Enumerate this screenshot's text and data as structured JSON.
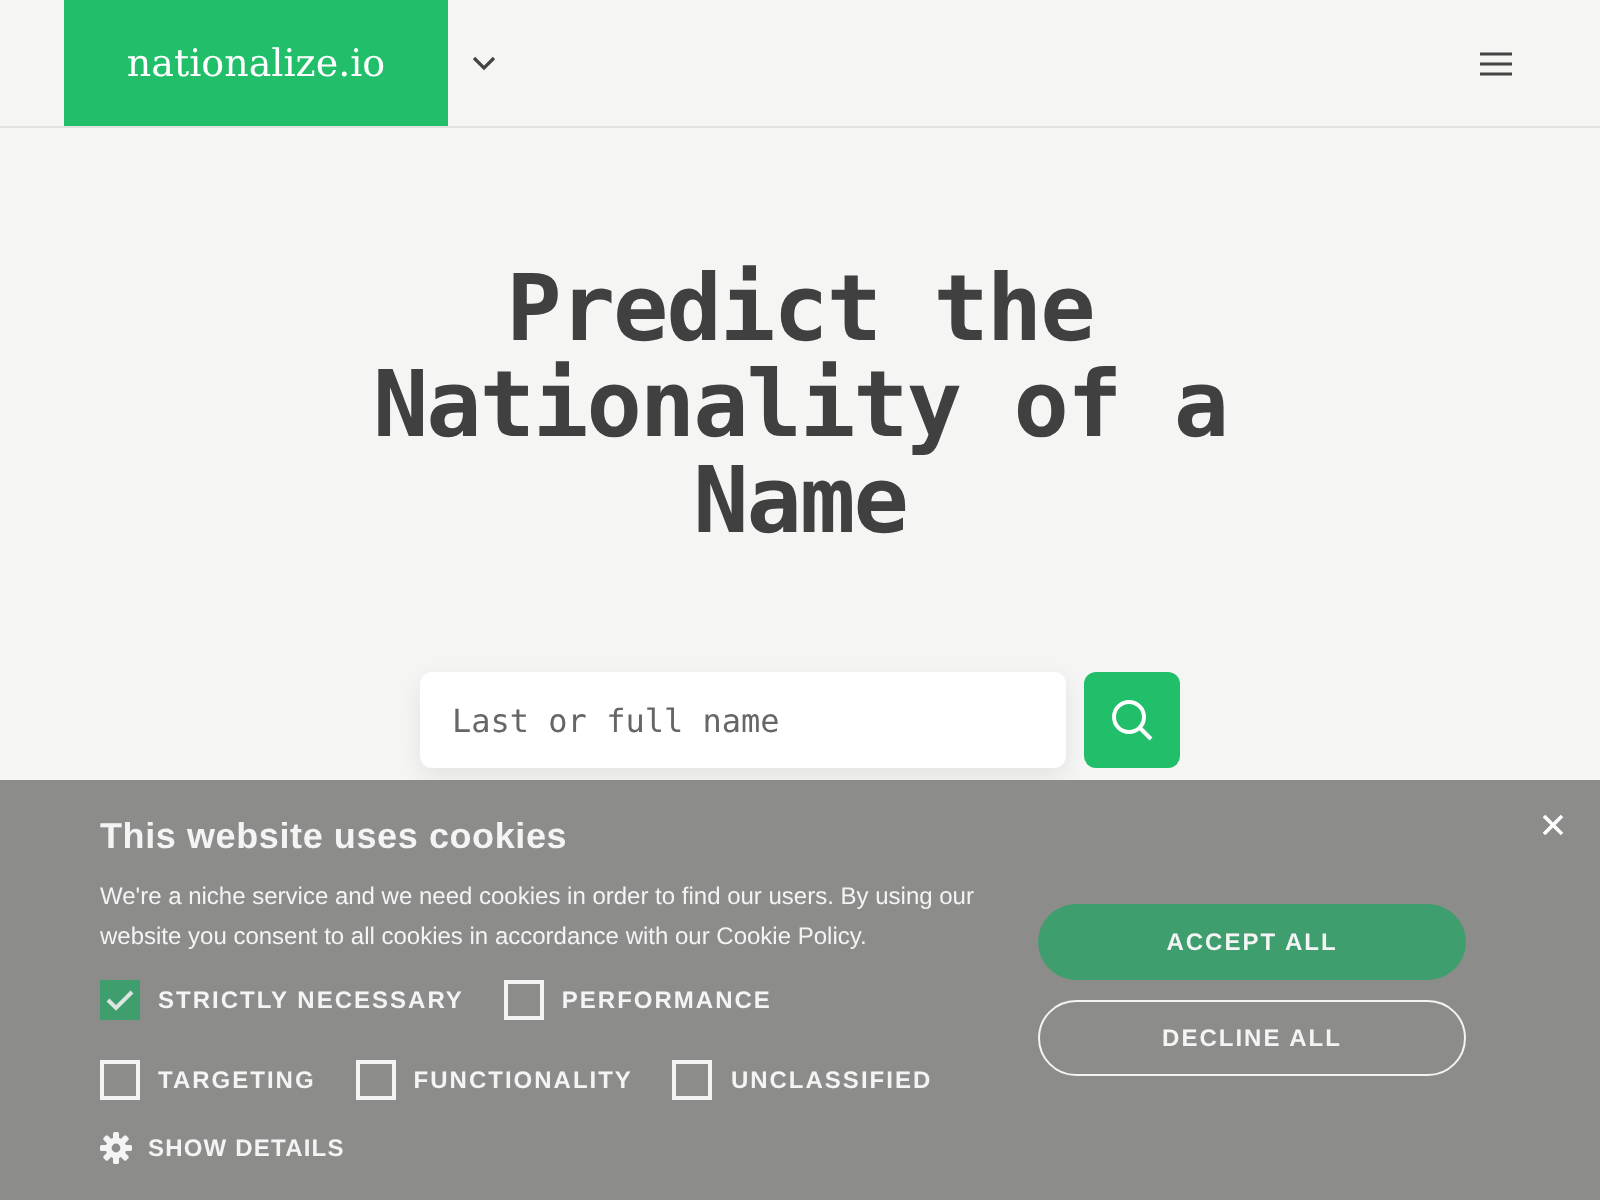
{
  "header": {
    "logo": "nationalize.io"
  },
  "hero": {
    "title": "Predict the Nationality of a Name",
    "search_placeholder": "Last or full name"
  },
  "cookie_banner": {
    "title": "This website uses cookies",
    "text": "We're a niche service and we need cookies in order to find our users. By using our website you consent to all cookies in accordance with our Cookie Policy.",
    "categories": [
      {
        "label": "STRICTLY NECESSARY",
        "checked": true
      },
      {
        "label": "PERFORMANCE",
        "checked": false
      },
      {
        "label": "TARGETING",
        "checked": false
      },
      {
        "label": "FUNCTIONALITY",
        "checked": false
      },
      {
        "label": "UNCLASSIFIED",
        "checked": false
      }
    ],
    "show_details": "SHOW DETAILS",
    "accept": "ACCEPT ALL",
    "decline": "DECLINE ALL"
  }
}
